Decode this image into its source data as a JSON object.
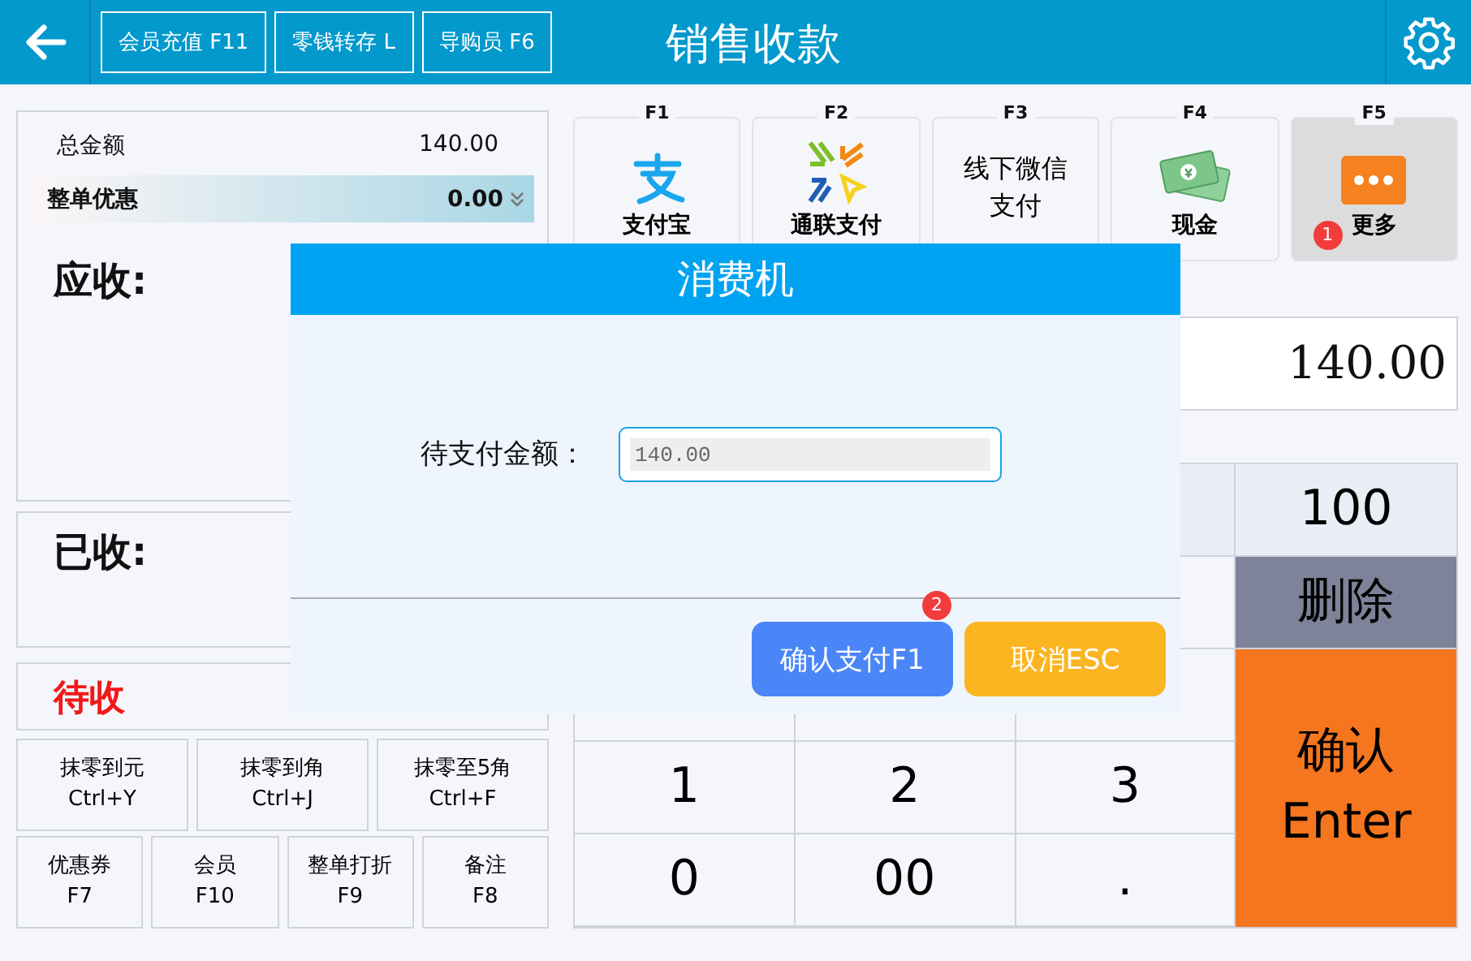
{
  "top_bar": {
    "title": "销售收款",
    "buttons": [
      "会员充值 F11",
      "零钱转存 L",
      "导购员 F6"
    ]
  },
  "summary": {
    "total_label": "总金额",
    "total_value": "140.00",
    "discount_label": "整单优惠",
    "discount_value": "0.00",
    "receivable_label": "应收:",
    "received_label": "已收:",
    "pending_label": "待收"
  },
  "rounding_buttons": [
    {
      "label": "抹零到元",
      "shortcut": "Ctrl+Y"
    },
    {
      "label": "抹零到角",
      "shortcut": "Ctrl+J"
    },
    {
      "label": "抹零至5角",
      "shortcut": "Ctrl+F"
    }
  ],
  "function_buttons": [
    {
      "label": "优惠券",
      "shortcut": "F7"
    },
    {
      "label": "会员",
      "shortcut": "F10"
    },
    {
      "label": "整单打折",
      "shortcut": "F9"
    },
    {
      "label": "备注",
      "shortcut": "F8"
    }
  ],
  "payment_methods": [
    {
      "key": "F1",
      "label": "支付宝",
      "kind": "alipay",
      "selected": false
    },
    {
      "key": "F2",
      "label": "通联支付",
      "kind": "allinpay",
      "selected": false
    },
    {
      "key": "F3",
      "label": "线下微信支付",
      "kind": "text",
      "selected": false
    },
    {
      "key": "F4",
      "label": "现金",
      "kind": "cash",
      "selected": false
    },
    {
      "key": "F5",
      "label": "更多",
      "kind": "more",
      "selected": true,
      "badge": "1"
    }
  ],
  "amount_input": {
    "value": "140.00"
  },
  "keypad": {
    "side_keys": [
      {
        "label": "100",
        "kind": "amount"
      },
      {
        "label": "删除",
        "kind": "delete"
      },
      {
        "label": "确认",
        "sublabel": "Enter",
        "kind": "confirm"
      }
    ],
    "digit_rows": [
      [
        "1",
        "2",
        "3"
      ],
      [
        "0",
        "00",
        "."
      ]
    ]
  },
  "dialog": {
    "title": "消费机",
    "field_label": "待支付金额：",
    "field_value": "140.00",
    "buttons": [
      {
        "label": "确认支付F1",
        "kind": "primary",
        "badge": "2"
      },
      {
        "label": "取消ESC",
        "kind": "cancel"
      }
    ]
  }
}
